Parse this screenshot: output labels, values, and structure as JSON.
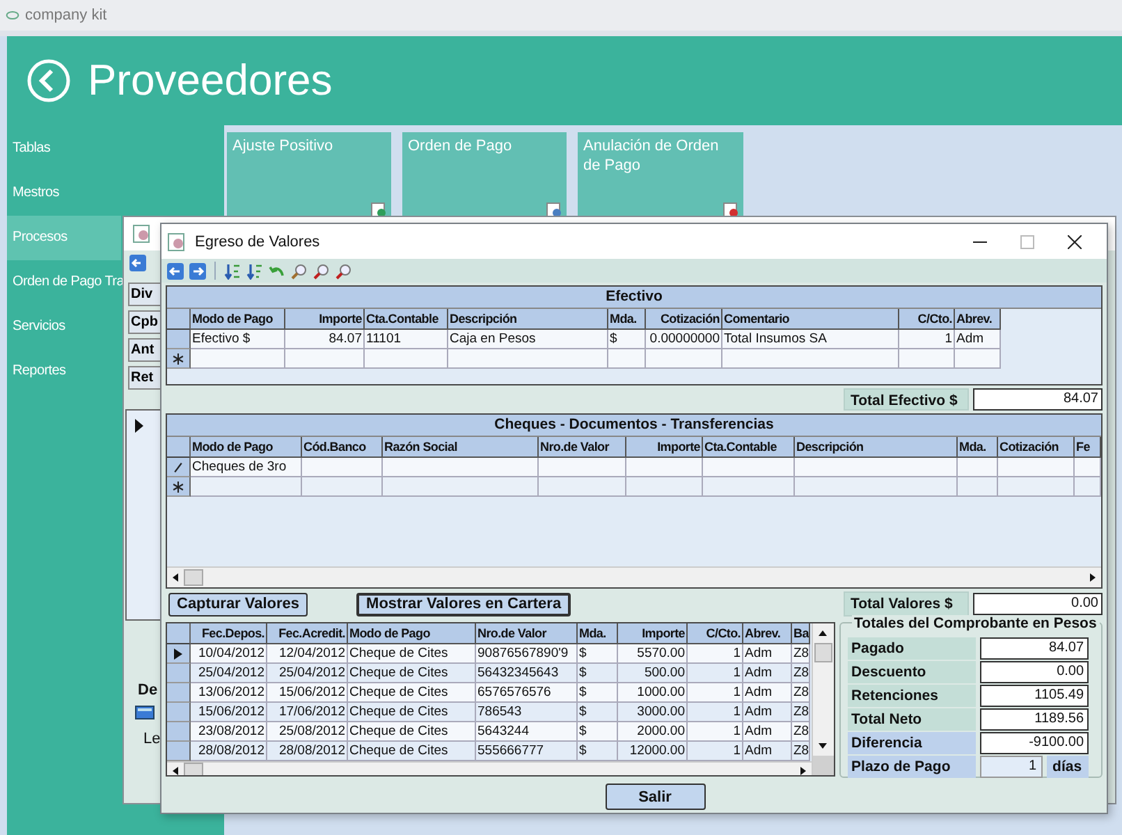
{
  "app": {
    "title": "company kit",
    "heading": "Proveedores"
  },
  "sidebar": {
    "items": [
      {
        "label": "Tablas",
        "selected": false
      },
      {
        "label": "Mestros",
        "selected": false
      },
      {
        "label": "Procesos",
        "selected": true
      },
      {
        "label": "Orden de Pago Tra",
        "selected": false
      },
      {
        "label": "Servicios",
        "selected": false
      },
      {
        "label": "Reportes",
        "selected": false
      }
    ]
  },
  "tiles": [
    {
      "label": "Ajuste Positivo",
      "kind": "add"
    },
    {
      "label": "Orden de Pago",
      "kind": "doc"
    },
    {
      "label": "Anulación de Orden de Pago",
      "kind": "cancel"
    }
  ],
  "back_window": {
    "buttons": [
      "Div",
      "Cpb",
      "Ant",
      "Ret"
    ],
    "section_label": "De",
    "group_label": "Le"
  },
  "dialog": {
    "title": "Egreso de Valores",
    "efectivo": {
      "title": "Efectivo",
      "new_row": true,
      "columns": [
        "Modo de Pago",
        "Importe",
        "Cta.Contable",
        "Descripción",
        "Mda.",
        "Cotización",
        "Comentario",
        "C/Cto.",
        "Abrev."
      ],
      "rows": [
        [
          "Efectivo $",
          "84.07",
          "11101",
          "Caja en Pesos",
          "$",
          "0.00000000",
          "Total Insumos SA",
          "1",
          "Adm"
        ]
      ]
    },
    "total_efectivo": {
      "label": "Total Efectivo $",
      "value": "84.07"
    },
    "cheques": {
      "title": "Cheques - Documentos - Transferencias",
      "new_row": true,
      "columns": [
        "Modo de Pago",
        "Cód.Banco",
        "Razón Social",
        "Nro.de Valor",
        "Importe",
        "Cta.Contable",
        "Descripción",
        "Mda.",
        "Cotización",
        "Fe"
      ],
      "rows": [
        {
          "editing": true,
          "modo_de_pago": "Cheques de 3ro"
        }
      ]
    },
    "buttons": [
      "Capturar Valores",
      "Mostrar Valores en Cartera"
    ],
    "total_valores": {
      "label": "Total Valores $",
      "value": "0.00"
    },
    "cartera": {
      "columns": [
        "Fec.Depos.",
        "Fec.Acredit.",
        "Modo de Pago",
        "Nro.de Valor",
        "Mda.",
        "Importe",
        "C/Cto.",
        "Abrev.",
        "Ba"
      ],
      "rows": [
        {
          "selected": true,
          "cells": [
            "10/04/2012",
            "12/04/2012",
            "Cheque de Cites",
            "90876567890'9",
            "$",
            "5570.00",
            "1",
            "Adm",
            "Z8"
          ]
        },
        {
          "selected": false,
          "cells": [
            "25/04/2012",
            "25/04/2012",
            "Cheque de Cites",
            "56432345643",
            "$",
            "500.00",
            "1",
            "Adm",
            "Z8"
          ]
        },
        {
          "selected": false,
          "cells": [
            "13/06/2012",
            "15/06/2012",
            "Cheque de Cites",
            "6576576576",
            "$",
            "1000.00",
            "1",
            "Adm",
            "Z8"
          ]
        },
        {
          "selected": false,
          "cells": [
            "15/06/2012",
            "17/06/2012",
            "Cheque de Cites",
            "786543",
            "$",
            "3000.00",
            "1",
            "Adm",
            "Z8"
          ]
        },
        {
          "selected": false,
          "cells": [
            "23/08/2012",
            "25/08/2012",
            "Cheque de Cites",
            "5643244",
            "$",
            "2000.00",
            "1",
            "Adm",
            "Z8"
          ]
        },
        {
          "selected": false,
          "cells": [
            "28/08/2012",
            "28/08/2012",
            "Cheque de Cites",
            "555666777",
            "$",
            "12000.00",
            "1",
            "Adm",
            "Z8"
          ]
        }
      ]
    },
    "totales": {
      "title": "Totales del Comprobante en Pesos",
      "rows": [
        {
          "label": "Pagado",
          "value": "84.07",
          "kind": "total"
        },
        {
          "label": "Descuento",
          "value": "0.00",
          "kind": "total"
        },
        {
          "label": "Retenciones",
          "value": "1105.49",
          "kind": "total"
        },
        {
          "label": "Total Neto",
          "value": "1189.56",
          "kind": "total"
        },
        {
          "label": "Diferencia",
          "value": "-9100.00",
          "kind": "highlight"
        }
      ],
      "plazo": {
        "label": "Plazo de Pago",
        "value": "1",
        "unit": "días"
      }
    },
    "exit_button": "Salir"
  }
}
